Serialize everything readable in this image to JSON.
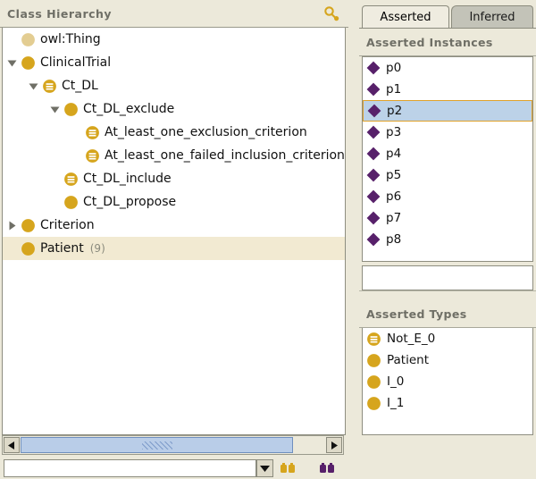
{
  "left_panel": {
    "title": "Class Hierarchy",
    "search_icon": "magnifier-search-icon",
    "tree": [
      {
        "label": "owl:Thing",
        "count": "",
        "depth": 0,
        "twisty": "none",
        "icon": "class-circle-pale"
      },
      {
        "label": "ClinicalTrial",
        "count": "",
        "depth": 0,
        "twisty": "expanded",
        "icon": "class-circle"
      },
      {
        "label": "Ct_DL",
        "count": "",
        "depth": 1,
        "twisty": "expanded",
        "icon": "defined-class"
      },
      {
        "label": "Ct_DL_exclude",
        "count": "",
        "depth": 2,
        "twisty": "expanded",
        "icon": "class-circle"
      },
      {
        "label": "At_least_one_exclusion_criterion",
        "count": "",
        "depth": 3,
        "twisty": "none",
        "icon": "defined-class"
      },
      {
        "label": "At_least_one_failed_inclusion_criterion",
        "count": "",
        "depth": 3,
        "twisty": "none",
        "icon": "defined-class"
      },
      {
        "label": "Ct_DL_include",
        "count": "",
        "depth": 2,
        "twisty": "none",
        "icon": "defined-class"
      },
      {
        "label": "Ct_DL_propose",
        "count": "",
        "depth": 2,
        "twisty": "none",
        "icon": "class-circle"
      },
      {
        "label": "Criterion",
        "count": "",
        "depth": 0,
        "twisty": "collapsed",
        "icon": "class-circle"
      },
      {
        "label": "Patient",
        "count": "(9)",
        "depth": 0,
        "twisty": "none",
        "icon": "class-circle",
        "selected": true
      }
    ],
    "scrollbar": {
      "left_arrow": "scroll-left-arrow",
      "right_arrow": "scroll-right-arrow",
      "grip": "scroll-thumb-grip"
    },
    "bottom": {
      "combo_value": "",
      "combo_placeholder": "",
      "dropdown_icon": "chevron-down-icon",
      "button_a_icon": "class-search-icon",
      "button_b_icon": "individual-search-icon"
    }
  },
  "right_panel": {
    "tabs": [
      {
        "label": "Asserted",
        "active": true
      },
      {
        "label": "Inferred",
        "active": false
      }
    ],
    "instances_section": {
      "title": "Asserted Instances",
      "items": [
        {
          "label": "p0",
          "selected": false
        },
        {
          "label": "p1",
          "selected": false
        },
        {
          "label": "p2",
          "selected": true
        },
        {
          "label": "p3",
          "selected": false
        },
        {
          "label": "p4",
          "selected": false
        },
        {
          "label": "p5",
          "selected": false
        },
        {
          "label": "p6",
          "selected": false
        },
        {
          "label": "p7",
          "selected": false
        },
        {
          "label": "p8",
          "selected": false
        }
      ],
      "field_value": ""
    },
    "types_section": {
      "title": "Asserted Types",
      "items": [
        {
          "label": "Not_E_0",
          "icon": "defined-class"
        },
        {
          "label": "Patient",
          "icon": "class-circle"
        },
        {
          "label": "I_0",
          "icon": "class-circle"
        },
        {
          "label": "I_1",
          "icon": "class-circle"
        }
      ]
    }
  },
  "colors": {
    "gold": "#d6a51d",
    "gold_pale": "#e3cd92",
    "purple": "#57206a",
    "panel_bg": "#ece9da",
    "selection_blue": "#bcd2e8",
    "selection_border": "#e0a12a",
    "tree_selection": "#f2ead2"
  }
}
